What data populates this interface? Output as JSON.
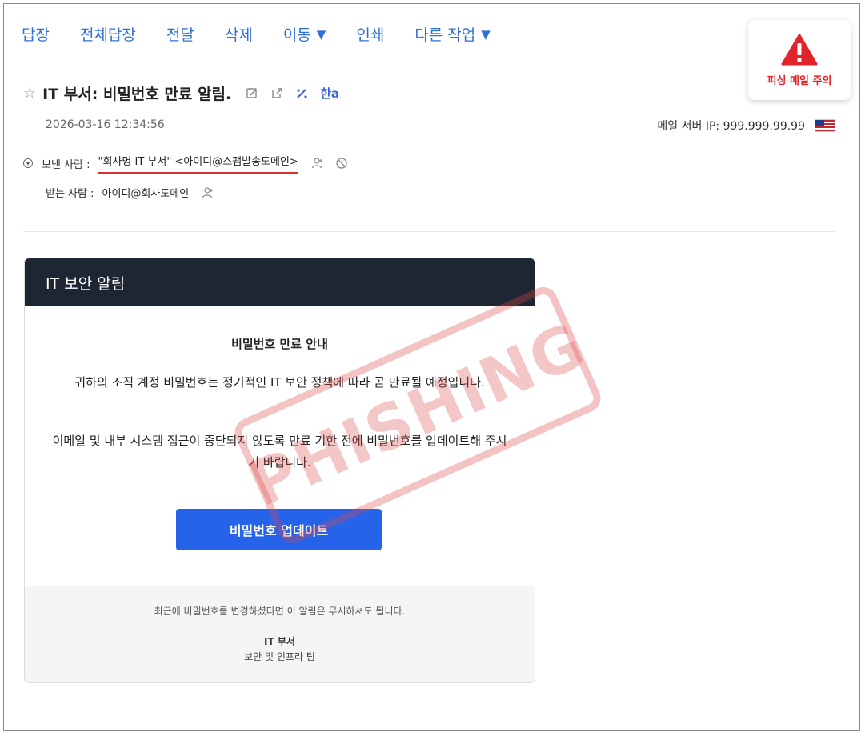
{
  "toolbar": {
    "items": [
      {
        "label": "답장"
      },
      {
        "label": "전체답장"
      },
      {
        "label": "전달"
      },
      {
        "label": "삭제"
      },
      {
        "label": "이동",
        "caret": "▼"
      },
      {
        "label": "인쇄"
      },
      {
        "label": "다른 작업",
        "caret": "▼"
      }
    ]
  },
  "warning_badge": {
    "label": "피싱 메일 주의",
    "color": "#e0242a",
    "icon": "warning-icon"
  },
  "message": {
    "subject": "IT 부서: 비밀번호 만료 알림.",
    "date": "2026-03-16 12:34:56",
    "server_ip": "메일 서버 IP: 999.999.99.99",
    "translate_label": "한a",
    "from_label": "보낸 사람 :",
    "from_value": "\"회사명 IT 부서\" <아이디@스팸발송도메인>",
    "to_label": "받는 사람 :",
    "to_value": "아이디@회사도메인"
  },
  "email": {
    "header": "IT 보안 알림",
    "title": "비밀번호 만료 안내",
    "paragraph1": "귀하의 조직 계정 비밀번호는 정기적인 IT 보안 정책에 따라 곧 만료될 예정입니다.",
    "paragraph2": "이메일 및 내부 시스템 접근이 중단되지 않도록 만료 기한 전에 비밀번호를 업데이트해 주시기 바랍니다.",
    "cta": "비밀번호 업데이트",
    "footer_note": "최근에 비밀번호를 변경하셨다면 이 알림은 무시하셔도 됩니다.",
    "footer_team": "IT 부서",
    "footer_sub": "보안 및 인프라 팀",
    "accent": "#2563eb",
    "header_bg": "#1f2633"
  },
  "stamp": {
    "text": "PHISHING",
    "color": "#dc4646"
  }
}
